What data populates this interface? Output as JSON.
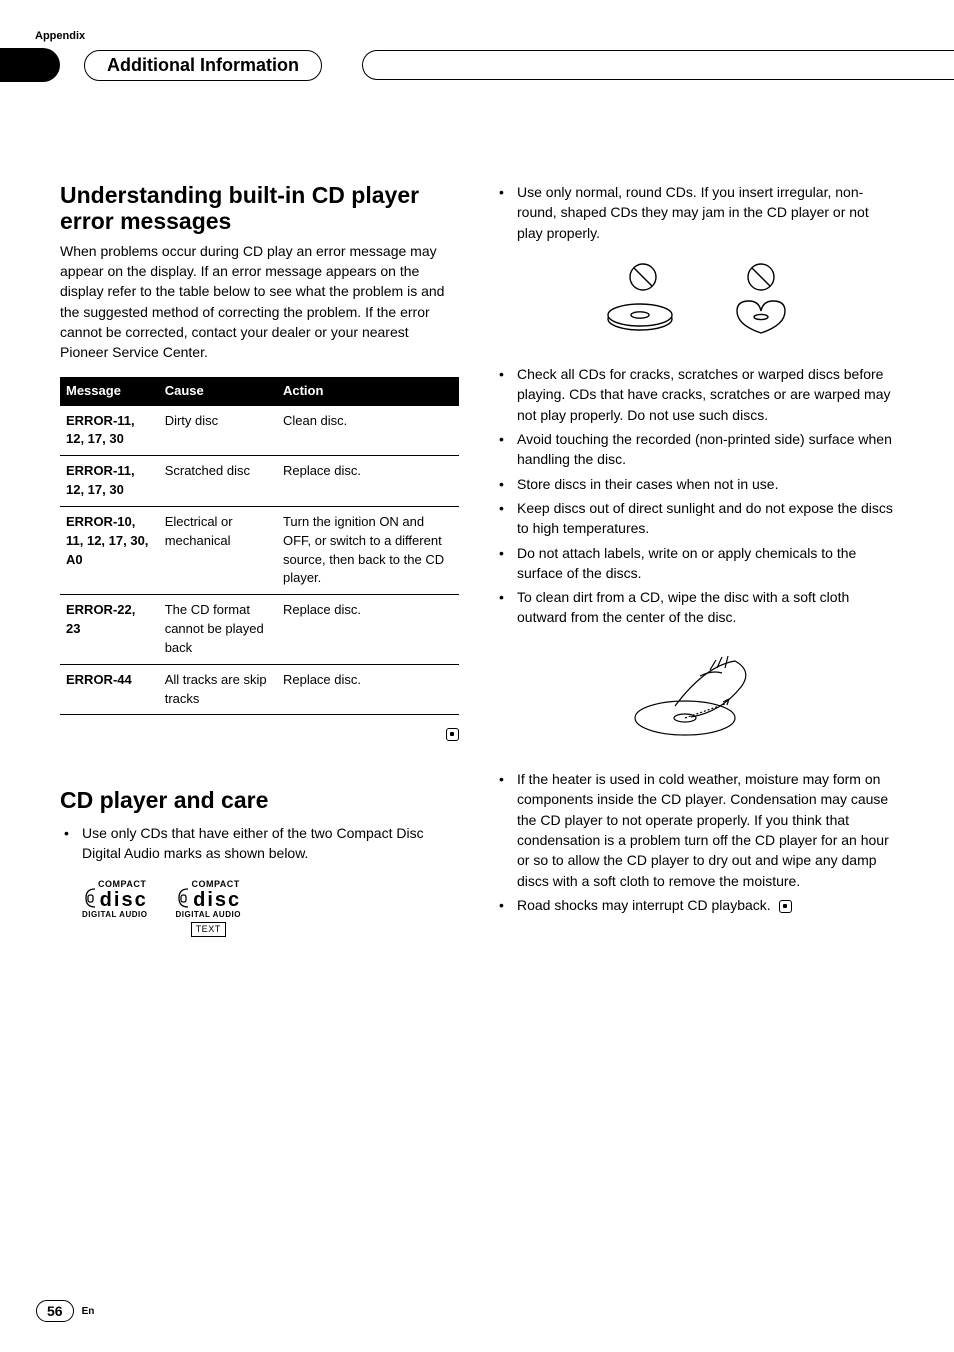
{
  "header": {
    "appendix": "Appendix",
    "section_title": "Additional Information"
  },
  "left": {
    "title": "Understanding built-in CD player error messages",
    "intro": "When problems occur during CD play an error message may appear on the display. If an error message appears on the display refer to the table below to see what the problem is and the suggested method of correcting the problem. If the error cannot be corrected, contact your dealer or your nearest Pioneer Service Center.",
    "table": {
      "headers": {
        "message": "Message",
        "cause": "Cause",
        "action": "Action"
      },
      "rows": [
        {
          "message": "ERROR-11, 12, 17, 30",
          "cause": "Dirty disc",
          "action": "Clean disc."
        },
        {
          "message": "ERROR-11, 12, 17, 30",
          "cause": "Scratched disc",
          "action": "Replace disc."
        },
        {
          "message": "ERROR-10, 11, 12, 17, 30, A0",
          "cause": "Electrical or mechanical",
          "action": "Turn the ignition ON and OFF, or switch to a different source, then back to the CD player."
        },
        {
          "message": "ERROR-22, 23",
          "cause": "The CD format cannot be played back",
          "action": "Replace disc."
        },
        {
          "message": "ERROR-44",
          "cause": "All tracks are skip tracks",
          "action": "Replace disc."
        }
      ]
    },
    "care_title": "CD player and care",
    "care_bullets": [
      "Use only CDs that have either of the two Compact Disc Digital Audio marks as shown below."
    ],
    "logos": {
      "compact": "COMPACT",
      "disc": "disc",
      "digital_audio": "DIGITAL AUDIO",
      "text": "TEXT"
    }
  },
  "right": {
    "bullets_top": [
      "Use only normal, round CDs. If you insert irregular, non-round, shaped CDs they may jam in the CD player or not play properly."
    ],
    "bullets_mid": [
      "Check all CDs for cracks, scratches or warped discs before playing. CDs that have cracks, scratches or are warped may not play properly. Do not use such discs.",
      "Avoid touching the recorded (non-printed side) surface when handling the disc.",
      "Store discs in their cases when not in use.",
      "Keep discs out of direct sunlight and do not expose the discs to high temperatures.",
      "Do not attach labels, write on or apply chemicals to the surface of the discs.",
      "To clean dirt from a CD, wipe the disc with a soft cloth outward from the center of the disc."
    ],
    "bullets_bottom": [
      "If the heater is used in cold weather, moisture may form on components inside the CD player. Condensation may cause the CD player to not operate properly. If you think that condensation is a problem turn off the CD player for an hour or so to allow the CD player to dry out and wipe any damp discs with a soft cloth to remove the moisture.",
      "Road shocks may interrupt CD playback."
    ]
  },
  "footer": {
    "page_number": "56",
    "lang": "En"
  }
}
